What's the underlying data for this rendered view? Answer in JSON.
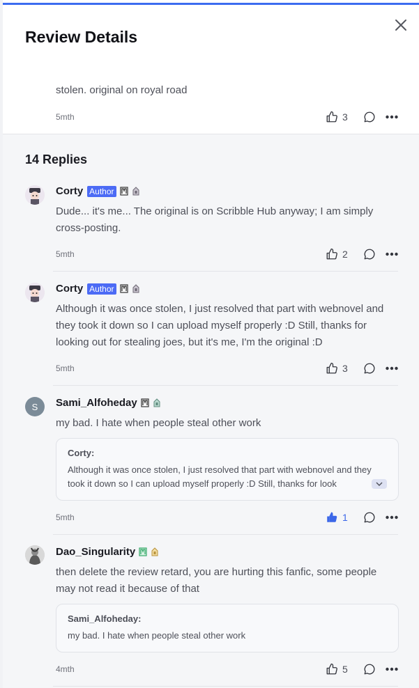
{
  "dialog": {
    "title": "Review Details"
  },
  "review": {
    "text": "stolen. original on royal road",
    "time": "5mth",
    "likes": "3"
  },
  "replies": {
    "title": "14 Replies",
    "items": [
      {
        "name": "Corty",
        "badge": "Author",
        "text": "Dude... it's me... The original is on Scribble Hub anyway; I am simply cross-posting.",
        "time": "5mth",
        "likes": "2"
      },
      {
        "name": "Corty",
        "badge": "Author",
        "text": "Although it was once stolen, I just resolved that part with webnovel and they took it down so I can upload myself properly :D Still, thanks for looking out for stealing joes, but it's me, I'm the original :D",
        "time": "5mth",
        "likes": "3"
      },
      {
        "name": "Sami_Alfoheday",
        "avatar_letter": "S",
        "text": "my bad. I hate when people steal other work",
        "quote_name": "Corty:",
        "quote_text": "Although it was once stolen, I just resolved that part with webnovel and they took it down so I can upload myself properly :D Still, thanks for look",
        "time": "5mth",
        "likes": "1"
      },
      {
        "name": "Dao_Singularity",
        "text": "then delete the review retard, you are hurting this fanfic, some people may not read it because of that",
        "quote_name": "Sami_Alfoheday:",
        "quote_text": "my bad. I hate when people steal other work",
        "time": "4mth",
        "likes": "5"
      }
    ]
  },
  "colors": {
    "accent": "#3b67e8",
    "author_badge": "#4c6bf5",
    "topline": "#3c6cf0"
  },
  "icons": [
    "close-icon",
    "thumbs-up-icon",
    "comment-icon",
    "more-icon",
    "level-badge-icon",
    "tier-badge-icon",
    "chevron-down-icon"
  ]
}
